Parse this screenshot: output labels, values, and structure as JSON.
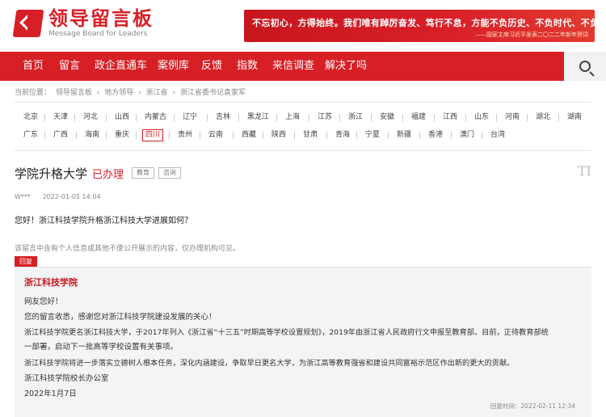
{
  "header": {
    "logo_cn": "领导留言板",
    "logo_en": "Message Board for Leaders",
    "banner_main": "不忘初心，方得始终。我们唯有踔厉奋发、笃行不怠，方能不负历史、不负时代、不负人民。",
    "banner_sub": "——国家主席习近平发表二〇二二年新年贺词"
  },
  "nav": {
    "items": [
      "首页",
      "留言",
      "政企直通车",
      "案例库",
      "反馈",
      "指数",
      "来信调查",
      "解决了吗"
    ],
    "search_icon": "search-icon"
  },
  "breadcrumb": {
    "items": [
      "当前位置：",
      "领导留言板",
      "›",
      "地方领导",
      "›",
      "浙江省",
      "›",
      "浙江省委书记袁家军"
    ]
  },
  "provinces": {
    "row1": [
      "北京",
      "天津",
      "河北",
      "山西",
      "内蒙古",
      "辽宁",
      "吉林",
      "黑龙江",
      "上海",
      "江苏",
      "浙江",
      "安徽",
      "福建",
      "江西",
      "山东",
      "河南",
      "湖北",
      "湖南"
    ],
    "row2": [
      "广东",
      "广西",
      "海南",
      "重庆",
      "四川",
      "贵州",
      "云南",
      "西藏",
      "陕西",
      "甘肃",
      "青海",
      "宁夏",
      "新疆",
      "香港",
      "澳门",
      "台湾"
    ],
    "active": "四川"
  },
  "message": {
    "title": "学院升格大学",
    "status": "已办理",
    "tags": [
      "教育",
      "咨询"
    ],
    "font_icon": "TI",
    "author": "W***",
    "date": "2022-01-05 14:04",
    "question": "您好！浙江科技学院升格浙江科技大学进展如何？",
    "privacy_note": "该留言中含有个人信息或其他不便公开展示的内容，仅办理机构可见。"
  },
  "reply": {
    "tag": "回复",
    "org": "浙江科技学院",
    "lines": [
      "网友您好！",
      "您的留言收悉，感谢您对浙江科技学院建设发展的关心！",
      "浙江科技学院更名浙江科技大学，于2017年列入《浙江省“十三五”时期高等学校设置规划》，2019年由浙江省人民政府行文申报至教育部。目前，正待教育部统",
      "一部署，启动下一批高等学校设置有关事项。",
      "浙江科技学院将进一步落实立德树人根本任务，深化内涵建设，争取早日更名大学，为浙江高等教育强省和建设共同富裕示范区作出新的更大的贡献。",
      "浙江科技学院校长办公室",
      "2022年1月7日"
    ],
    "time": "回复时间：2022-02-11 12:34"
  },
  "colors": {
    "brand": "#d71f26",
    "reply_bg": "#f3f4f6"
  }
}
